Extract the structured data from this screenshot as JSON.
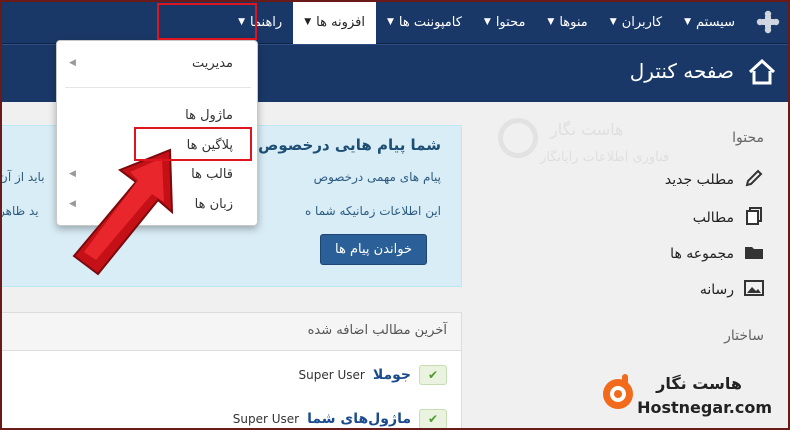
{
  "nav": {
    "items": [
      {
        "label": "سیستم"
      },
      {
        "label": "کاربران"
      },
      {
        "label": "منوها"
      },
      {
        "label": "محتوا"
      },
      {
        "label": "کامپوننت ها"
      },
      {
        "label": "افزونه ها"
      },
      {
        "label": "راهنما"
      }
    ]
  },
  "page": {
    "title": "صفحه کنترل"
  },
  "dropdown": {
    "items": [
      {
        "label": "مدیریت"
      },
      {
        "label": "ماژول ها"
      },
      {
        "label": "پلاگین ها"
      },
      {
        "label": "قالب ها"
      },
      {
        "label": "زبان ها"
      }
    ]
  },
  "message": {
    "title": "شما پیام هایی درخصوص",
    "line1": "پیام های مهمی درخصوص",
    "line1_tail": "باید از آن",
    "line2": "این اطلاعات زمانیکه شما ه",
    "line2_tail": "ید ظاهر",
    "button": "خواندن پیام ها"
  },
  "sidebar": {
    "content_heading": "محتوا",
    "items": [
      {
        "label": "مطلب جدید",
        "icon": "pencil-icon"
      },
      {
        "label": "مطالب",
        "icon": "copy-icon"
      },
      {
        "label": "مجموعه ها",
        "icon": "folder-icon"
      },
      {
        "label": "رسانه",
        "icon": "image-icon"
      }
    ],
    "structure_heading": "ساختار"
  },
  "latest": {
    "title": "آخرین مطالب اضافه شده",
    "rows": [
      {
        "title": "جوملا",
        "author": "Super User"
      },
      {
        "title": "ماژول‌های شما",
        "author": "Super User"
      }
    ]
  },
  "watermark": {
    "name": "هاست نگار",
    "tagline": "فناوری اطلاعات رایانگار"
  },
  "logo": {
    "name": "هاست نگار",
    "domain": "Hostnegar.com"
  },
  "colors": {
    "navbar": "#1a3867",
    "accent_red": "#e0141e",
    "button": "#2b5f97"
  }
}
